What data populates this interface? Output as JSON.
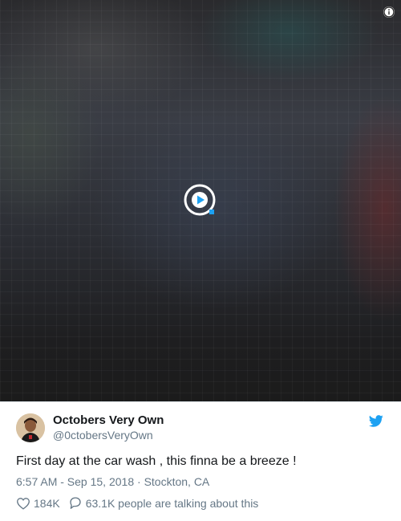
{
  "media": {
    "play_icon": "play-circle-icon",
    "info_icon": "info-icon"
  },
  "tweet": {
    "display_name": "Octobers Very Own",
    "handle": "@0ctobersVeryOwn",
    "text": "First day at the car wash , this finna be a breeze !",
    "time": "6:57 AM - Sep 15, 2018",
    "separator": " · ",
    "location": "Stockton, CA",
    "likes": "184K",
    "replies_text": "63.1K people are talking about this",
    "brand_icon": "twitter-bird-icon",
    "colors": {
      "brand": "#1da1f2",
      "text": "#14171a",
      "secondary": "#657786"
    }
  }
}
